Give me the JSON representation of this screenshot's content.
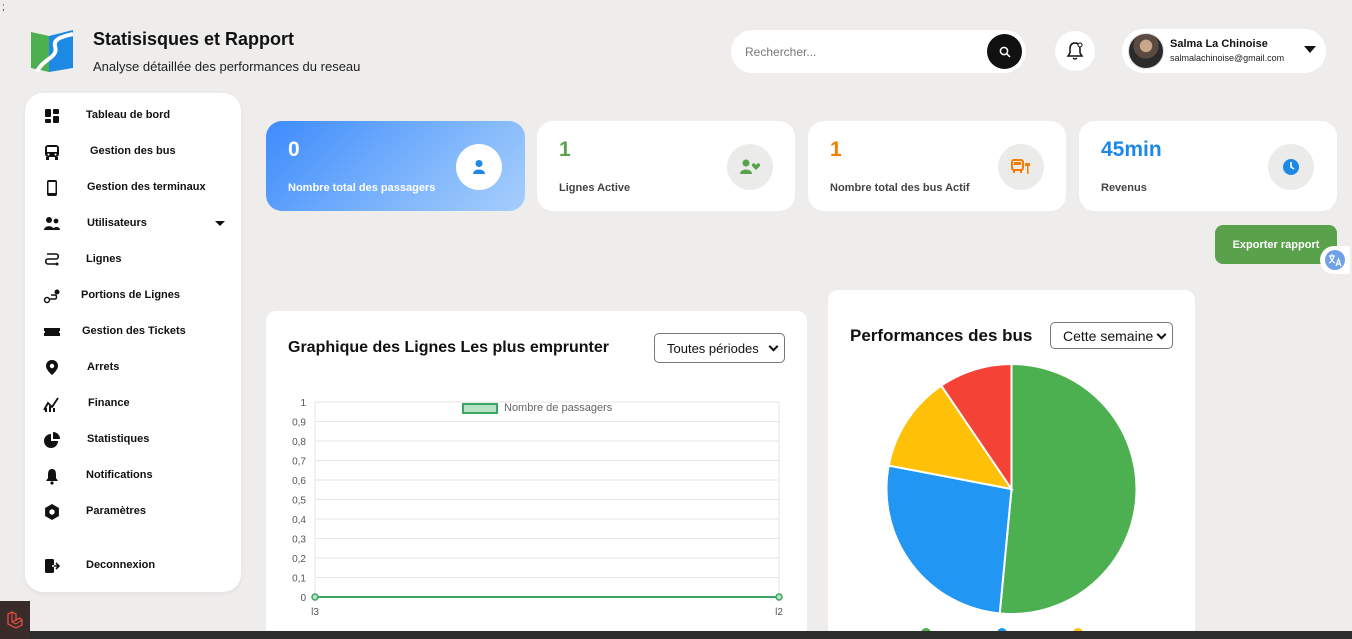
{
  "stray_char": ";",
  "header": {
    "title": "Statisisques et Rapport",
    "subtitle": "Analyse détaillée des performances du reseau"
  },
  "search": {
    "placeholder": "Rechercher..."
  },
  "user": {
    "name": "Salma La Chinoise",
    "email": "salmalachinoise@gmail.com"
  },
  "sidebar": {
    "items": [
      {
        "label": "Tableau de bord",
        "icon": "dashboard-icon"
      },
      {
        "label": "Gestion des bus",
        "icon": "bus-icon"
      },
      {
        "label": "Gestion des terminaux",
        "icon": "mobile-icon"
      },
      {
        "label": "Utilisateurs",
        "icon": "users-icon"
      },
      {
        "label": "Lignes",
        "icon": "route-icon"
      },
      {
        "label": "Portions de Lignes",
        "icon": "path-icon"
      },
      {
        "label": "Gestion des Tickets",
        "icon": "ticket-icon"
      },
      {
        "label": "Arrets",
        "icon": "map-pin-icon"
      },
      {
        "label": "Finance",
        "icon": "finance-icon"
      },
      {
        "label": "Statistiques",
        "icon": "pie-chart-icon"
      },
      {
        "label": "Notifications",
        "icon": "bell-icon"
      },
      {
        "label": "Paramètres",
        "icon": "gear-icon"
      },
      {
        "label": "Deconnexion",
        "icon": "logout-icon"
      }
    ]
  },
  "stats": [
    {
      "value": "0",
      "label": "Nombre total des passagers",
      "icon": "user-icon",
      "color": "#3d8bfd"
    },
    {
      "value": "1",
      "label": "Lignes Active",
      "icon": "user-heart-icon",
      "color": "#5aa14b"
    },
    {
      "value": "1",
      "label": "Nombre total des bus Actif",
      "icon": "bus-stop-icon",
      "color": "#f57c00"
    },
    {
      "value": "45min",
      "label": "Revenus",
      "icon": "clock-icon",
      "color": "#1e88e5"
    }
  ],
  "export_label": "Exporter rapport",
  "line_panel": {
    "title": "Graphique des Lignes Les plus emprunter",
    "select": "Toutes périodes"
  },
  "pie_panel": {
    "title": "Performances des bus",
    "select": "Cette semaine"
  },
  "chart_data": [
    {
      "type": "line",
      "series": [
        {
          "name": "Nombre de passagers",
          "values": [
            0,
            0
          ],
          "color": "#3da664"
        }
      ],
      "categories": [
        "l3",
        "l2"
      ],
      "ylim": [
        0,
        1
      ],
      "yticks": [
        "0",
        "0,1",
        "0,2",
        "0,3",
        "0,4",
        "0,5",
        "0,6",
        "0,7",
        "0,8",
        "0,9",
        "1"
      ],
      "grid": true,
      "legend": "top"
    },
    {
      "type": "pie",
      "slices": [
        {
          "value": 51.5,
          "color": "#4caf50"
        },
        {
          "value": 26.5,
          "color": "#2196f3"
        },
        {
          "value": 12.5,
          "color": "#ffc107"
        },
        {
          "value": 9.5,
          "color": "#f44336"
        }
      ]
    }
  ]
}
